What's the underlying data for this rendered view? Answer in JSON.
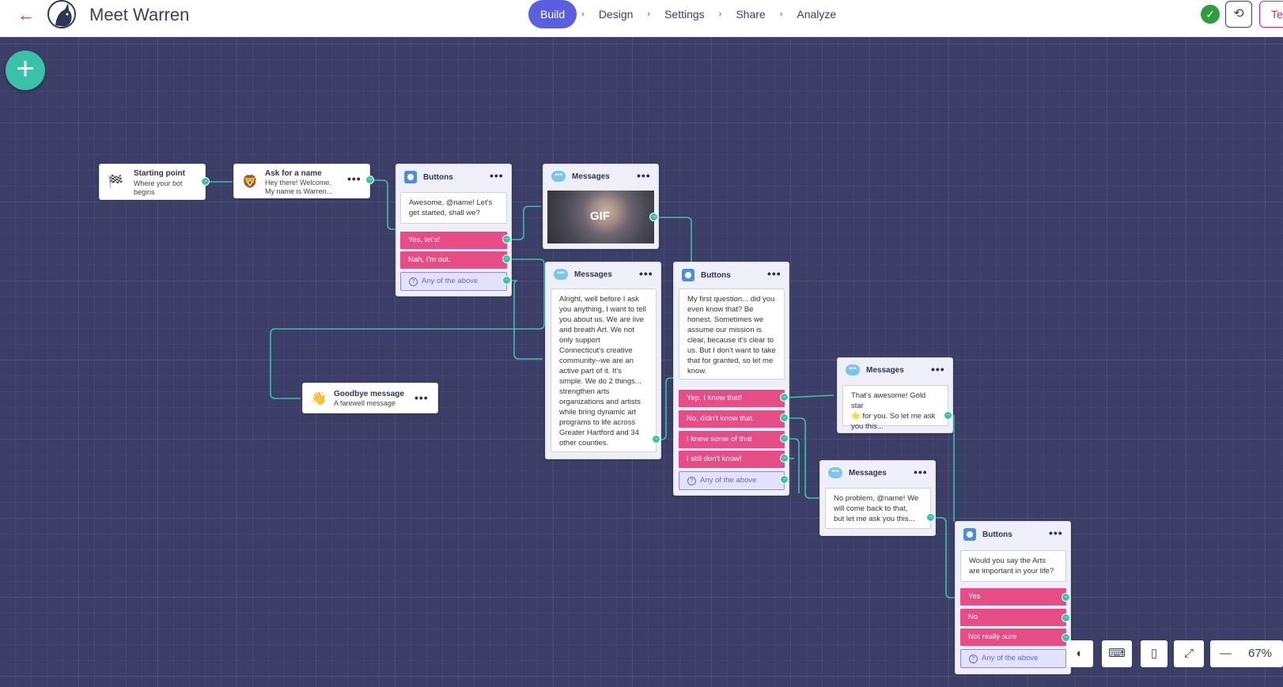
{
  "header": {
    "back_icon": "back-arrow-icon",
    "title": "Meet Warren",
    "steps": [
      "Build",
      "Design",
      "Settings",
      "Share",
      "Analyze"
    ],
    "active_step": "Build",
    "status_icon": "check-circle-icon",
    "history_icon": "history-icon",
    "test_label": "Te"
  },
  "canvas": {
    "add_icon": "plus-icon"
  },
  "nodes": {
    "start": {
      "title": "Starting point",
      "sub1": "Where your bot",
      "sub2": "begins"
    },
    "ask_name": {
      "title": "Ask for a name",
      "sub1": "Hey there! Welcome.",
      "sub2": "My name is Warren..."
    },
    "buttons1": {
      "title": "Buttons",
      "message1": "Awesome, @name! Let's",
      "message2": "get started, shall we?",
      "buttons": [
        "Yes, let's!",
        "Nah, I'm out."
      ],
      "any": "Any of the above"
    },
    "messages_gif": {
      "title": "Messages",
      "gif_label": "GIF"
    },
    "messages_about": {
      "title": "Messages",
      "lines": [
        "Alright, well before I ask",
        "you anything, I want to tell",
        "you about us. We are live",
        "and breath Art. We not",
        "only support",
        "Connecticut's creative",
        "community--we are an",
        "active part of it. It's",
        "simple. We do 2 things...",
        "strengthen arts",
        "organizations and artists",
        "while bring dynamic art",
        "programs to life across",
        "Greater Hartford and 34",
        "other counties."
      ]
    },
    "goodbye": {
      "title": "Goodbye message",
      "sub1": "A farewell message"
    },
    "buttons2": {
      "title": "Buttons",
      "lines": [
        "My first question... did you",
        "even know that? Be",
        "honest. Sometimes we",
        "assume our mission is",
        "clear, because it's clear to",
        "us. But I don't want to take",
        "that for granted, so let me",
        "know."
      ],
      "buttons": [
        "Yep, I knew that!",
        "No, didn't know that.",
        "I knew some of that",
        "I still don't know!"
      ],
      "any": "Any of the above"
    },
    "messages_gold": {
      "title": "Messages",
      "lines": [
        "That's awesome! Gold star",
        "🌟 for you. So let me ask",
        "you this..."
      ]
    },
    "messages_noproblem": {
      "title": "Messages",
      "lines": [
        "No problem, @name! We",
        "will come back to that,",
        "but let me ask you this..."
      ]
    },
    "buttons3": {
      "title": "Buttons",
      "lines": [
        "Would you say the Arts",
        "are important in your life?"
      ],
      "buttons": [
        "Yes",
        "No",
        "Not really sure"
      ],
      "any": "Any of the above"
    }
  },
  "toolbar": {
    "contrast_icon": "contrast-icon",
    "keyboard_icon": "keyboard-icon",
    "mouse_icon": "mouse-icon",
    "fit_icon": "fit-screen-icon",
    "zoom_out_icon": "minus-icon",
    "zoom": "67%"
  },
  "colors": {
    "canvas": "#3b3e66",
    "accent": "#5a5fe0",
    "button_pink": "#e64c86",
    "connector": "#3cc1a9",
    "danger": "#e0245e"
  }
}
